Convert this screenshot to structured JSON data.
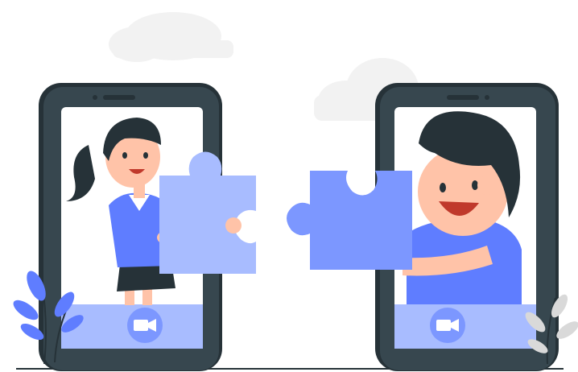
{
  "scene": {
    "description": "video-call-collaboration-illustration",
    "left_phone": {
      "person": "woman",
      "holds": "puzzle-piece",
      "call_button_icon": "video-camera-icon"
    },
    "right_phone": {
      "person": "man",
      "holds": "puzzle-piece",
      "call_button_icon": "video-camera-icon"
    },
    "colors": {
      "phone_body": "#37474f",
      "phone_screen": "#ffffff",
      "call_bar": "#a8bcff",
      "call_button": "#7c97ff",
      "puzzle_left": "#a8bcff",
      "puzzle_right": "#7c97ff",
      "shirt": "#5f7dff",
      "hair": "#263238",
      "skin": "#ffc3a8",
      "cloud": "#f2f2f2",
      "leaf_blue": "#5f7dff",
      "leaf_grey": "#d9d9d9"
    }
  }
}
